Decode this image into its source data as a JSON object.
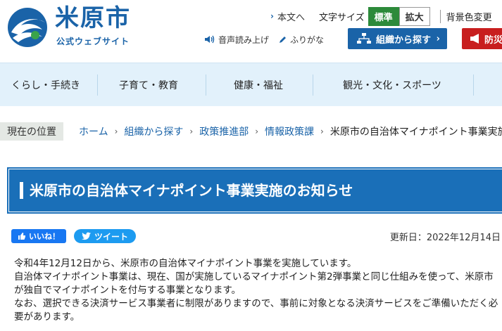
{
  "header": {
    "site_name": "米原市",
    "site_subtitle": "公式ウェブサイト",
    "lang_link": "本文へ",
    "font_size_label": "文字サイズ",
    "font_size_standard": "標準",
    "font_size_large": "拡大",
    "bg_color_label": "背景色変更",
    "read_aloud": "音声読み上げ",
    "furigana": "ふりがな",
    "org_search": "組織から探す",
    "disaster": "防災"
  },
  "nav": {
    "items": [
      "くらし・手続き",
      "子育て・教育",
      "健康・福祉",
      "観光・文化・スポーツ"
    ]
  },
  "breadcrumb": {
    "label": "現在の位置",
    "items": [
      "ホーム",
      "組織から探す",
      "政策推進部",
      "情報政策課"
    ],
    "current": "米原市の自治体マイナポイント事業実施"
  },
  "page": {
    "title": "米原市の自治体マイナポイント事業実施のお知らせ",
    "like_label": "いいね！",
    "tweet_label": "ツイート",
    "updated": "更新日：2022年12月14日",
    "paragraphs": [
      "令和4年12月12日から、米原市の自治体マイナポイント事業を実施しています。",
      "自治体マイナポイント事業は、現在、国が実施しているマイナポイント第2弾事業と同じ仕組みを使って、米原市が独自でマイナポイントを付与する事業となります。",
      "なお、選択できる決済サービス事業者に制限がありますので、事前に対象となる決済サービスをご準備いただく必要があります。"
    ]
  },
  "colors": {
    "brand": "#1a63a8",
    "nav_bg": "#e2f1fb",
    "standard_btn": "#2c8a3a",
    "disaster_btn": "#c81e1e"
  }
}
